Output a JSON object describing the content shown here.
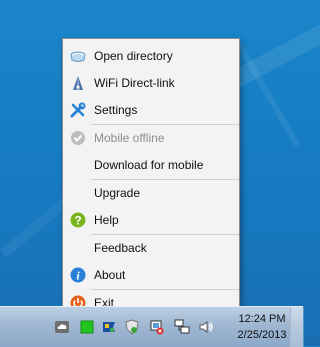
{
  "menu": {
    "items": [
      {
        "label": "Open directory",
        "icon": "folder-icon",
        "disabled": false
      },
      {
        "label": "WiFi Direct-link",
        "icon": "wifi-cone-icon",
        "disabled": false
      },
      {
        "label": "Settings",
        "icon": "tools-icon",
        "disabled": false
      },
      {
        "label": "Mobile offline",
        "icon": "check-circle-icon",
        "disabled": true
      },
      {
        "label": "Download for mobile",
        "icon": "",
        "disabled": false
      },
      {
        "label": "Upgrade",
        "icon": "",
        "disabled": false
      },
      {
        "label": "Help",
        "icon": "help-icon",
        "disabled": false
      },
      {
        "label": "Feedback",
        "icon": "",
        "disabled": false
      },
      {
        "label": "About",
        "icon": "info-icon",
        "disabled": false
      },
      {
        "label": "Exit",
        "icon": "power-icon",
        "disabled": false
      }
    ]
  },
  "taskbar": {
    "time": "12:24 PM",
    "date": "2/25/2013"
  },
  "colors": {
    "desktop": "#1679c0",
    "help_green": "#7ab51d",
    "info_blue": "#2a7fd6",
    "exit_orange": "#e8611a"
  }
}
